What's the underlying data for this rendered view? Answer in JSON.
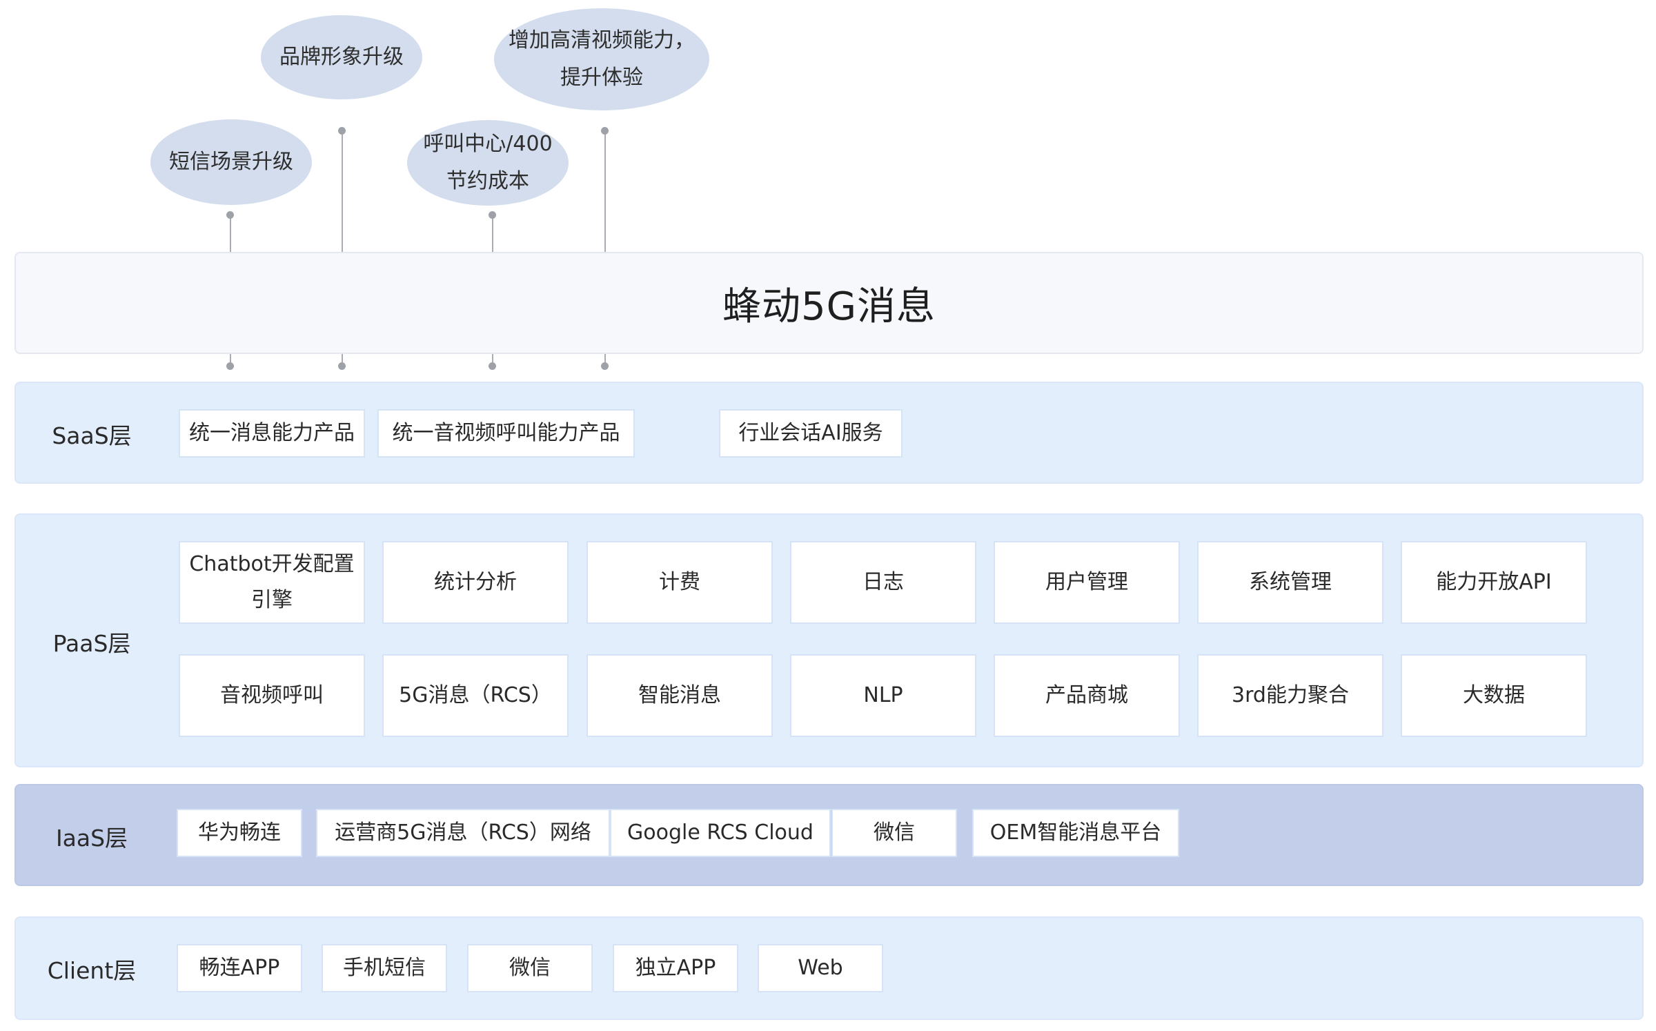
{
  "diagram": {
    "bubbles": [
      {
        "lines": [
          "短信场景升级"
        ]
      },
      {
        "lines": [
          "品牌形象升级"
        ]
      },
      {
        "lines": [
          "呼叫中心/400",
          "节约成本"
        ]
      },
      {
        "lines": [
          "增加高清视频能力，",
          "提升体验"
        ]
      }
    ],
    "title": "蜂动5G消息",
    "layers": {
      "saas": {
        "label": "SaaS层",
        "items": [
          "统一消息能力产品",
          "统一音视频呼叫能力产品",
          "行业会话AI服务"
        ]
      },
      "paas": {
        "label": "PaaS层",
        "row1": [
          {
            "lines": [
              "Chatbot开发配置",
              "引擎"
            ]
          },
          {
            "lines": [
              "统计分析"
            ]
          },
          {
            "lines": [
              "计费"
            ]
          },
          {
            "lines": [
              "日志"
            ]
          },
          {
            "lines": [
              "用户管理"
            ]
          },
          {
            "lines": [
              "系统管理"
            ]
          },
          {
            "lines": [
              "能力开放API"
            ]
          }
        ],
        "row2": [
          "音视频呼叫",
          "5G消息（RCS）",
          "智能消息",
          "NLP",
          "产品商城",
          "3rd能力聚合",
          "大数据"
        ]
      },
      "iaas": {
        "label": "IaaS层",
        "items": [
          "华为畅连",
          "运营商5G消息（RCS）网络",
          "Google RCS Cloud",
          "微信",
          "OEM智能消息平台"
        ]
      },
      "client": {
        "label": "Client层",
        "items": [
          "畅连APP",
          "手机短信",
          "微信",
          "独立APP",
          "Web"
        ]
      }
    }
  }
}
